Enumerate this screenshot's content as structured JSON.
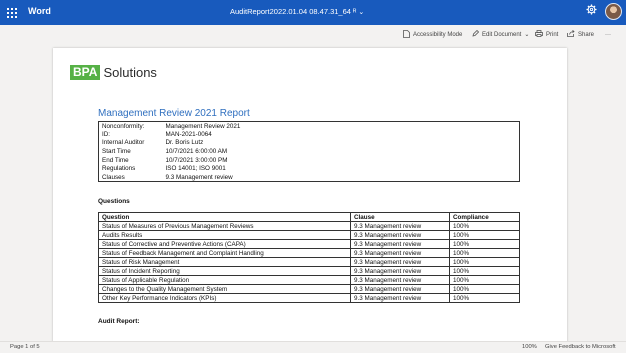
{
  "titlebar": {
    "app_name": "Word",
    "doc_title": "AuditReport2022.01.04 08.47.31_64",
    "doc_title_suffix": "ᴿ",
    "chevron": "⌄",
    "settings_icon": "gear-icon",
    "avatar_icon": "user-avatar"
  },
  "toolbar": {
    "accessibility_label": "Accessibility Mode",
    "edit_label": "Edit Document",
    "edit_chevron": "⌄",
    "print_label": "Print",
    "share_label": "Share",
    "more_label": "···"
  },
  "document": {
    "logo_bpa": "BPA",
    "logo_solutions": "Solutions",
    "report_title": "Management Review 2021 Report",
    "info": [
      {
        "key": "Nonconformity:",
        "value": "Management Review 2021"
      },
      {
        "key": "ID:",
        "value": "MAN-2021-0064"
      },
      {
        "key": "Internal Auditor",
        "value": "Dr. Boris Lutz"
      },
      {
        "key": "Start Time",
        "value": "10/7/2021  6:00:00  AM"
      },
      {
        "key": "End Time",
        "value": "10/7/2021  3:00:00  PM"
      },
      {
        "key": "Regulations",
        "value": "ISO 14001;  ISO 9001"
      },
      {
        "key": "Clauses",
        "value": "9.3 Management review"
      }
    ],
    "questions_heading": "Questions",
    "questions_header": {
      "question": "Question",
      "clause": "Clause",
      "compliance": "Compliance"
    },
    "questions": [
      {
        "question": "Status of Measures of Previous Management Reviews",
        "clause": "9.3 Management review",
        "compliance": "100%"
      },
      {
        "question": "Audits Results",
        "clause": "9.3 Management review",
        "compliance": "100%"
      },
      {
        "question": "Status of Corrective and Preventive Actions (CAPA)",
        "clause": "9.3 Management review",
        "compliance": "100%"
      },
      {
        "question": "Status of Feedback Management and Complaint Handling",
        "clause": "9.3 Management review",
        "compliance": "100%"
      },
      {
        "question": "Status of Risk Management",
        "clause": "9.3 Management review",
        "compliance": "100%"
      },
      {
        "question": "Status of Incident Reporting",
        "clause": "9.3 Management review",
        "compliance": "100%"
      },
      {
        "question": "Status of Applicable Regulation",
        "clause": "9.3 Management review",
        "compliance": "100%"
      },
      {
        "question": "Changes to the Quality Management System",
        "clause": "9.3 Management review",
        "compliance": "100%"
      },
      {
        "question": "Other Key Performance Indicators (KPIs)",
        "clause": "9.3 Management review",
        "compliance": "100%"
      }
    ],
    "audit_report_heading": "Audit Report:"
  },
  "statusbar": {
    "page_info": "Page 1 of 5",
    "zoom": "100%",
    "feedback": "Give Feedback to Microsoft"
  }
}
